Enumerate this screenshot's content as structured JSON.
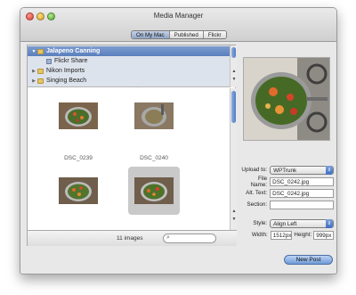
{
  "window": {
    "title": "Media Manager"
  },
  "source_tabs": [
    {
      "label": "On My Mac",
      "active": true
    },
    {
      "label": "Published",
      "active": false
    },
    {
      "label": "Flickr",
      "active": false
    }
  ],
  "tree": [
    {
      "label": "Jalapeno Canning",
      "icon": "folder-icon",
      "selected": true,
      "expanded": true
    },
    {
      "label": "Flickr Share",
      "icon": "flickr-icon",
      "selected": false,
      "child": true
    },
    {
      "label": "Nikon Imports",
      "icon": "folder-icon",
      "selected": false
    },
    {
      "label": "Singing Beach",
      "icon": "folder-icon",
      "selected": false
    }
  ],
  "thumbnails": [
    {
      "caption": "DSC_0239",
      "selected": false
    },
    {
      "caption": "DSC_0240",
      "selected": false
    },
    {
      "caption": "",
      "selected": false
    },
    {
      "caption": "",
      "selected": true
    }
  ],
  "status": {
    "image_count": "11 images"
  },
  "form": {
    "upload_to_label": "Upload to:",
    "upload_to_value": "WPTrunk",
    "file_name_label": "File Name:",
    "file_name_value": "DSC_0242.jpg",
    "alt_text_label": "Alt. Text:",
    "alt_text_value": "DSC_0242.jpg",
    "section_label": "Section:",
    "section_value": "",
    "style_label": "Style:",
    "style_value": "Align Left",
    "width_label": "Width:",
    "width_value": "1512px",
    "height_label": "Height:",
    "height_value": "999px"
  },
  "actions": {
    "new_post": "New Post"
  },
  "colors": {
    "selection_blue": "#5a7fbd",
    "accent_button": "#6f9ad6"
  }
}
